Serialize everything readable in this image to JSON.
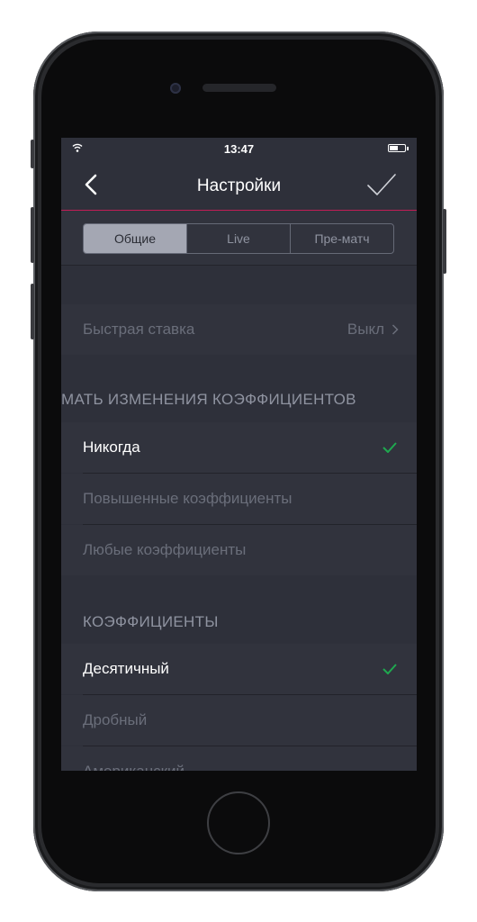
{
  "status_bar": {
    "time": "13:47"
  },
  "nav": {
    "title": "Настройки"
  },
  "tabs": [
    "Общие",
    "Live",
    "Пре-матч"
  ],
  "quick_bet": {
    "label": "Быстрая ставка",
    "value": "Выкл"
  },
  "odds_change": {
    "header": "МАТЬ ИЗМЕНЕНИЯ КОЭФФИЦИЕНТОВ",
    "options": [
      "Никогда",
      "Повышенные коэффициенты",
      "Любые коэффициенты"
    ],
    "selected": "Никогда"
  },
  "odds_format": {
    "header": "КОЭФФИЦИЕНТЫ",
    "options": [
      "Десятичный",
      "Дробный",
      "Американский"
    ],
    "selected": "Десятичный"
  },
  "colors": {
    "accent": "#c21d55",
    "check": "#1fa84f",
    "background": "#2e303a"
  }
}
